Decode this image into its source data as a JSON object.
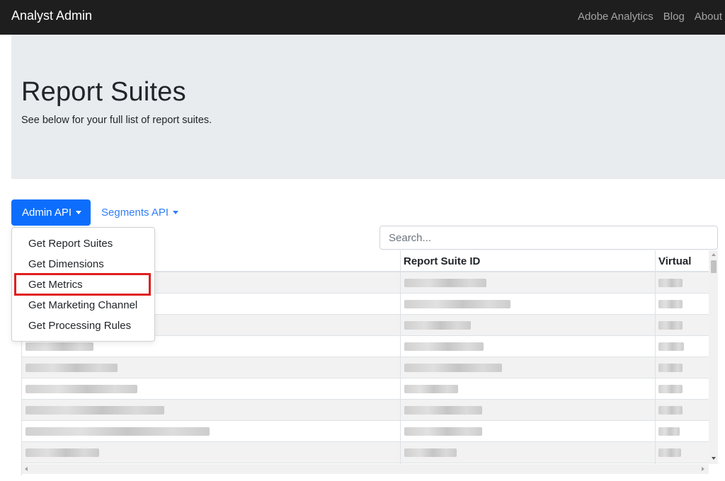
{
  "navbar": {
    "brand": "Analyst Admin",
    "links": [
      "Adobe Analytics",
      "Blog",
      "About"
    ]
  },
  "jumbotron": {
    "title": "Report Suites",
    "lead": "See below for your full list of report suites."
  },
  "toolbar": {
    "admin_api_label": "Admin API",
    "segments_api_label": "Segments API"
  },
  "dropdown": {
    "items": [
      "Get Report Suites",
      "Get Dimensions",
      "Get Metrics",
      "Get Marketing Channel",
      "Get Processing Rules"
    ],
    "highlighted": "Get Metrics"
  },
  "search": {
    "placeholder": "Search..."
  },
  "table": {
    "columns": [
      "",
      "Report Suite ID",
      "Virtual"
    ],
    "row_count_visible": 9
  },
  "colors": {
    "navbar_bg": "#1e1e1e",
    "primary": "#0d6efd",
    "link": "#2f7ff7",
    "jumbotron_bg": "#e9ecef",
    "highlight": "#e01e1e"
  }
}
